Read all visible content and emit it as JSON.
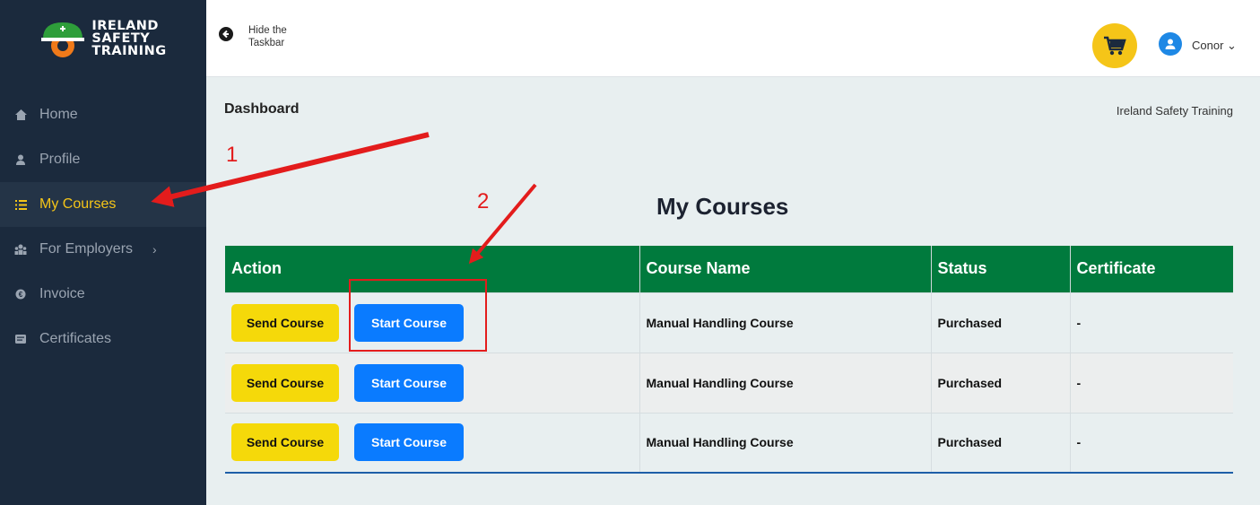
{
  "logo": {
    "line1": "IRELAND",
    "line2": "SAFETY",
    "line3": "TRAINING"
  },
  "sidebar": {
    "items": [
      {
        "label": "Home",
        "icon": "home-icon"
      },
      {
        "label": "Profile",
        "icon": "user-icon"
      },
      {
        "label": "My Courses",
        "icon": "list-icon",
        "active": true
      },
      {
        "label": "For Employers",
        "icon": "group-icon",
        "chevron": "›"
      },
      {
        "label": "Invoice",
        "icon": "invoice-icon"
      },
      {
        "label": "Certificates",
        "icon": "certificate-icon"
      }
    ]
  },
  "topbar": {
    "hide_label": "Hide the Taskbar",
    "user_name": "Conor ⌄"
  },
  "main": {
    "breadcrumb": "Dashboard",
    "site_name": "Ireland Safety Training",
    "title": "My Courses"
  },
  "table": {
    "headers": [
      "Action",
      "Course Name",
      "Status",
      "Certificate"
    ],
    "send_label": "Send Course",
    "start_label": "Start Course",
    "rows": [
      {
        "course": "Manual Handling Course",
        "status": "Purchased",
        "certificate": "-"
      },
      {
        "course": "Manual Handling Course",
        "status": "Purchased",
        "certificate": "-"
      },
      {
        "course": "Manual Handling Course",
        "status": "Purchased",
        "certificate": "-"
      }
    ]
  },
  "annotations": {
    "step1": "1",
    "step2": "2"
  },
  "colors": {
    "sidebar": "#1b2a3d",
    "accent": "#f5c518",
    "header_green": "#007a3d",
    "primary_blue": "#0a7bff",
    "annotation_red": "#e31c1c"
  }
}
